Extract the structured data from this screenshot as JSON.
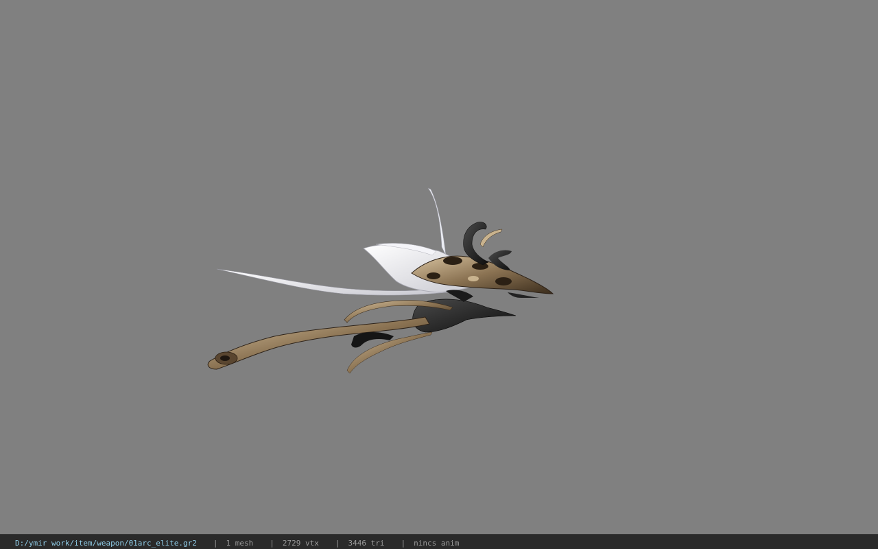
{
  "viewport": {
    "background_color": "#808080",
    "model_icon": "bow-weapon-model"
  },
  "status_bar": {
    "file_path": "D:/ymir work/item/weapon/01arc_elite.gr2",
    "separator": "|",
    "mesh_count": "1 mesh",
    "vertex_count": "2729 vtx",
    "triangle_count": "3446 tri",
    "animation": "nincs anim",
    "path_color": "#8fcbe6",
    "text_color": "#9a9a9a",
    "background_color": "#2a2a2a"
  }
}
